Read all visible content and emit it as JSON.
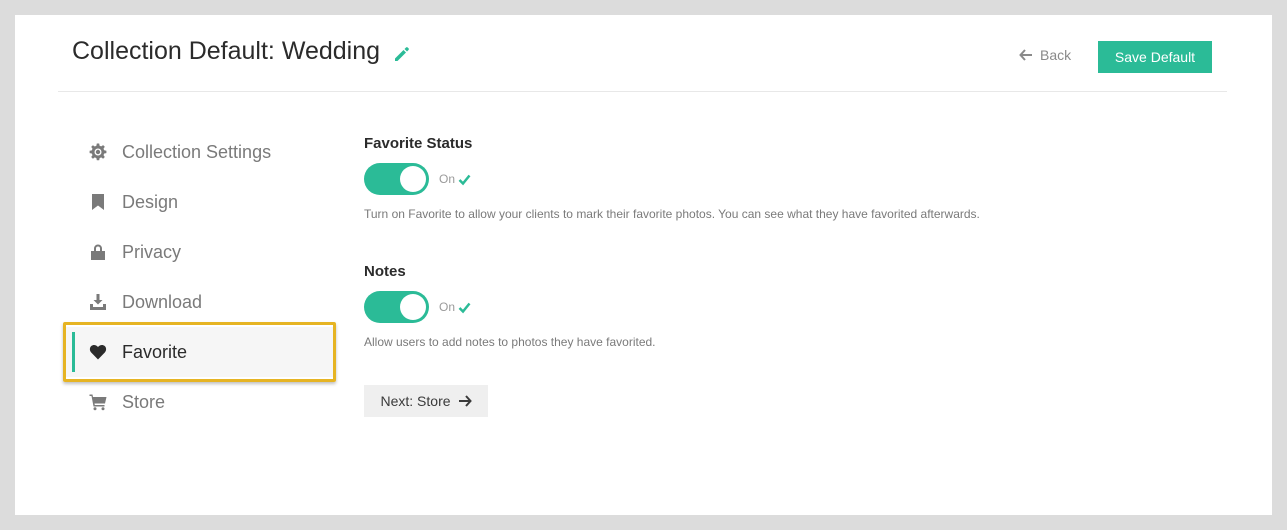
{
  "header": {
    "title": "Collection Default: Wedding",
    "back_label": "Back",
    "save_label": "Save Default"
  },
  "sidebar": {
    "items": [
      {
        "label": "Collection Settings",
        "icon": "gear-icon"
      },
      {
        "label": "Design",
        "icon": "bookmark-icon"
      },
      {
        "label": "Privacy",
        "icon": "lock-icon"
      },
      {
        "label": "Download",
        "icon": "download-icon"
      },
      {
        "label": "Favorite",
        "icon": "heart-icon",
        "active": true
      },
      {
        "label": "Store",
        "icon": "cart-icon"
      }
    ]
  },
  "main": {
    "favorite": {
      "title": "Favorite Status",
      "state": "On",
      "help": "Turn on Favorite to allow your clients to mark their favorite photos. You can see what they have favorited afterwards."
    },
    "notes": {
      "title": "Notes",
      "state": "On",
      "help": "Allow users to add notes to photos they have favorited."
    },
    "next_label": "Next: Store"
  },
  "colors": {
    "accent": "#2bbb97",
    "highlight": "#e6b423"
  }
}
